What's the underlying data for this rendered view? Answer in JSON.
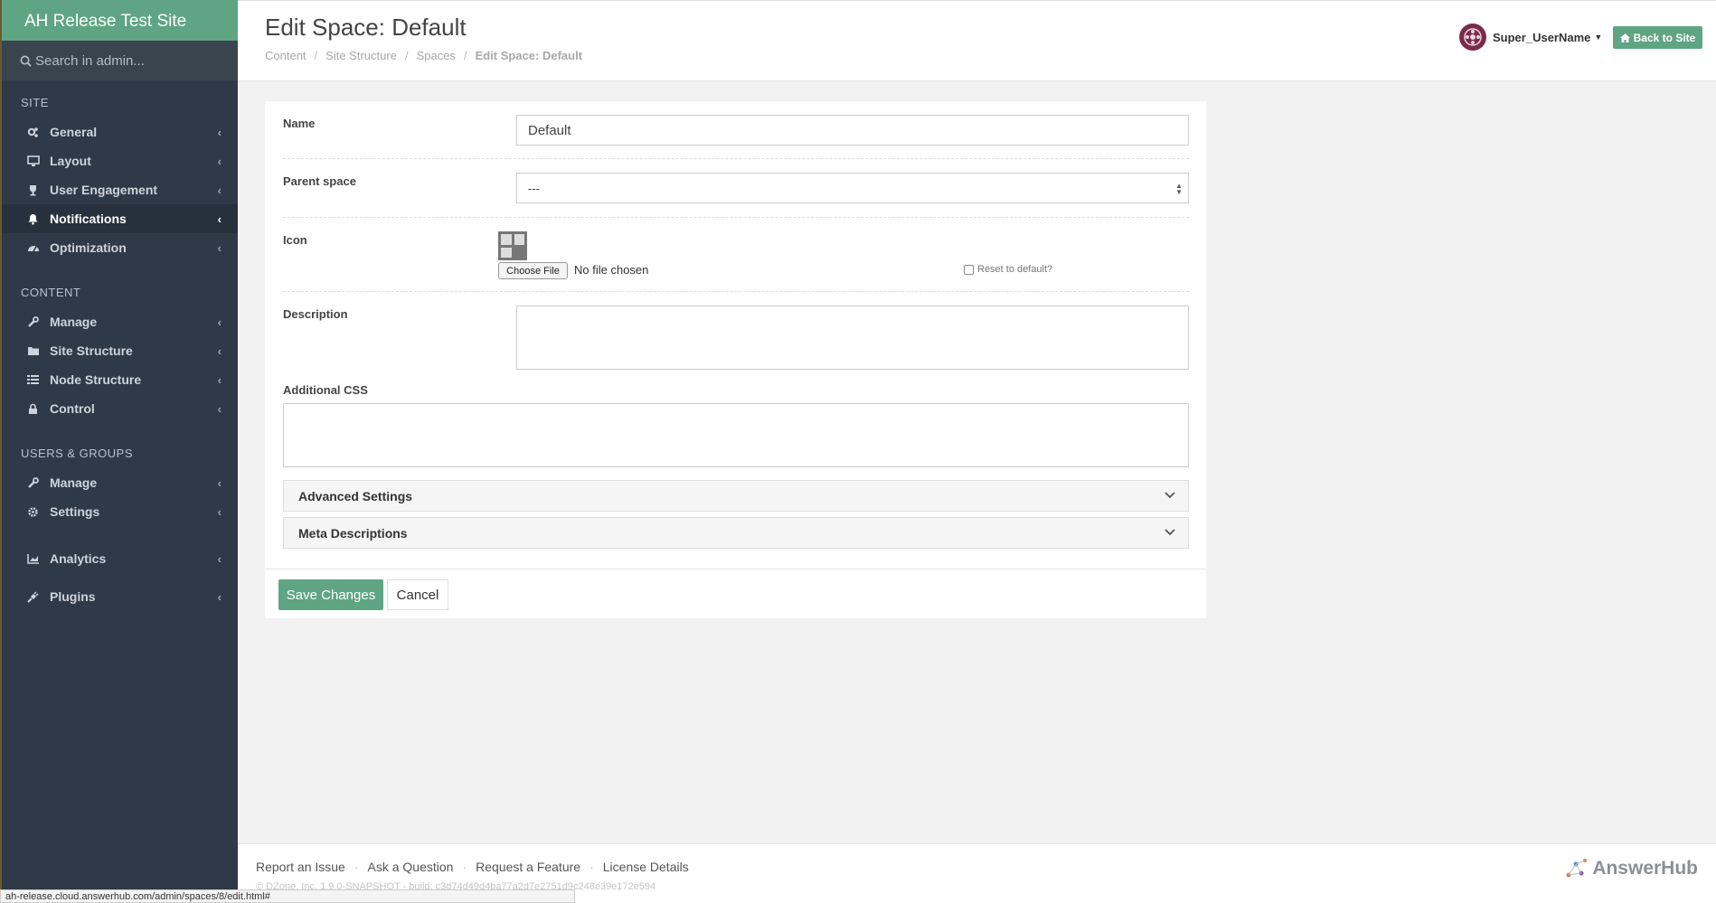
{
  "sidebar": {
    "brand": "AH Release Test Site",
    "search_placeholder": "Search in admin...",
    "sections": [
      {
        "header": "SITE",
        "items": [
          {
            "label": "General",
            "icon": "cogs-icon"
          },
          {
            "label": "Layout",
            "icon": "desktop-icon"
          },
          {
            "label": "User Engagement",
            "icon": "trophy-icon"
          },
          {
            "label": "Notifications",
            "icon": "bell-icon",
            "active": true
          },
          {
            "label": "Optimization",
            "icon": "dashboard-icon"
          }
        ]
      },
      {
        "header": "CONTENT",
        "items": [
          {
            "label": "Manage",
            "icon": "wrench-icon"
          },
          {
            "label": "Site Structure",
            "icon": "folder-icon"
          },
          {
            "label": "Node Structure",
            "icon": "list-icon"
          },
          {
            "label": "Control",
            "icon": "lock-icon"
          }
        ]
      },
      {
        "header": "USERS & GROUPS",
        "items": [
          {
            "label": "Manage",
            "icon": "wrench-icon"
          },
          {
            "label": "Settings",
            "icon": "cog-icon"
          }
        ]
      },
      {
        "header": "",
        "items": [
          {
            "label": "Analytics",
            "icon": "chart-icon"
          },
          {
            "label": "Plugins",
            "icon": "plug-icon"
          }
        ]
      }
    ]
  },
  "header": {
    "title": "Edit Space: Default",
    "breadcrumb": [
      "Content",
      "Site Structure",
      "Spaces",
      "Edit Space: Default"
    ],
    "username": "Super_UserName",
    "back_label": "Back to Site"
  },
  "form": {
    "name_label": "Name",
    "name_value": "Default",
    "parent_label": "Parent space",
    "parent_value": "---",
    "icon_label": "Icon",
    "choose_file": "Choose File",
    "no_file": "No file chosen",
    "reset_label": "Reset to default?",
    "description_label": "Description",
    "css_label": "Additional CSS",
    "advanced_label": "Advanced Settings",
    "meta_label": "Meta Descriptions",
    "save_label": "Save Changes",
    "cancel_label": "Cancel"
  },
  "footer": {
    "links": [
      "Report an Issue",
      "Ask a Question",
      "Request a Feature",
      "License Details"
    ],
    "copyright": "© DZone, Inc. 1.9.0-SNAPSHOT - build: c3d74d49d4ba77a2d7e2751d9c248e39e172e594",
    "logo": "AnswerHub"
  },
  "status_url": "ah-release.cloud.answerhub.com/admin/spaces/8/edit.html#",
  "colors": {
    "accent": "#5fa583",
    "sidebar": "#2f3a48"
  }
}
